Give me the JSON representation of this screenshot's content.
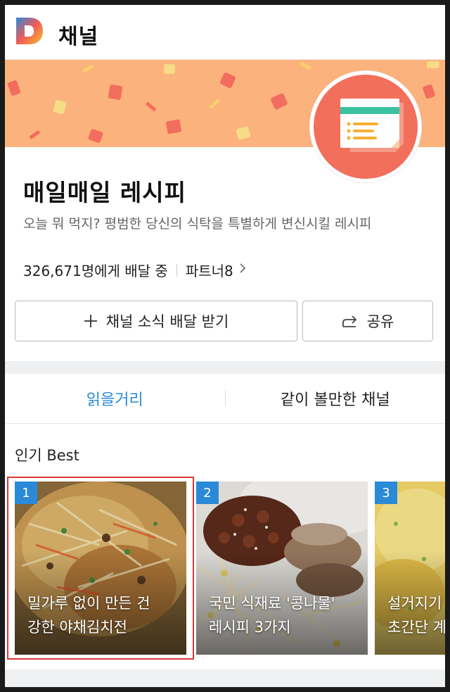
{
  "header": {
    "title": "채널",
    "logo_icon": "daum-d-logo-icon"
  },
  "channel": {
    "name": "매일매일 레시피",
    "description": "오늘 뭐 먹지? 평범한 당신의 식탁을 특별하게 변신시킬 레시피",
    "subscribers": "326,671명에게 배달 중",
    "partners": "파트너8",
    "avatar_icon": "recipe-card-icon"
  },
  "buttons": {
    "subscribe": "채널 소식 배달 받기",
    "share": "공유"
  },
  "tabs": [
    {
      "label": "읽을거리",
      "active": true
    },
    {
      "label": "같이 볼만한 채널",
      "active": false
    }
  ],
  "popular": {
    "title": "인기 Best",
    "items": [
      {
        "rank": "1",
        "title": "밀가루 없이 만든 건\n강한 야채김치전"
      },
      {
        "rank": "2",
        "title": "국민 식재료 '콩나물'\n레시피 3가지"
      },
      {
        "rank": "3",
        "title": "설거지기\n초간단 계"
      }
    ]
  },
  "colors": {
    "accent": "#2a8ad8",
    "banner": "#fbb27c",
    "avatar": "#f26f5c",
    "selection": "#d9383a"
  }
}
